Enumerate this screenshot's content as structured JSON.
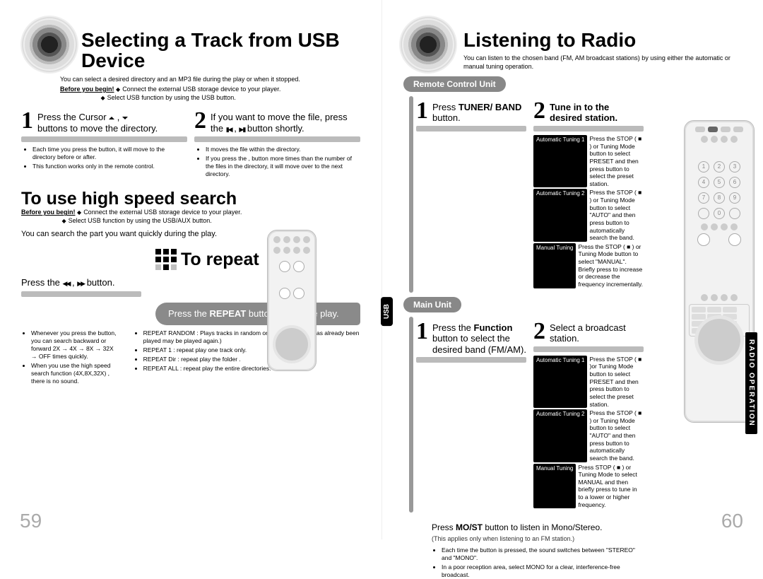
{
  "left": {
    "title": "Selecting a Track from USB Device",
    "intro": "You can select a desired directory and an MP3 file during the play or when it stopped.",
    "before_label": "Before you begin!",
    "before1": "Connect the external USB storage device to your player.",
    "before2": "Select USB function by using the USB button.",
    "step1": {
      "text_a": "Press the Cursor ",
      "text_b": " , ",
      "text_c": " buttons to move the directory.",
      "n1": "Each time you press the button, it will move to the directory before or after.",
      "n2": "This function works only in the remote control."
    },
    "step2": {
      "text_a": "If you want to move the file, press the ",
      "text_b": " , ",
      "text_c": "button shortly.",
      "n1": "It moves the file within the directory.",
      "n2": "If you press the     ,     button more times than the number of the files in the directory, it will move over to the next directory."
    },
    "h2a": "To use high speed search",
    "hs_before_label": "Before you begin!",
    "hs_b1": "Connect the external USB storage device to your player.",
    "hs_b2": "Select USB function by using the USB/AUX button.",
    "hs_intro": "You can search the part you want quickly during the play.",
    "hs_press_a": "Press the ",
    "hs_press_b": " , ",
    "hs_press_c": " button.",
    "hs_n1": "Whenever you press the button, you can search backward or forward 2X → 4X → 8X → 32X → OFF times quickly.",
    "hs_n2": "When you use the high speed search function (4X,8X,32X) , there is no sound.",
    "repeat_title": "To repeat",
    "repeat_pill_a": "Press the ",
    "repeat_pill_b": "REPEAT",
    "repeat_pill_c": " button during the play.",
    "rp_n1": "REPEAT RANDOM : Plays tracks in random order. (A track that has already been played may be played again.)",
    "rp_n2": "REPEAT 1 : repeat play one track only.",
    "rp_n3": "REPEAT Dir : repeat play the folder .",
    "rp_n4": "REPEAT ALL : repeat play the entire directories.",
    "page": "59"
  },
  "right": {
    "title": "Listening to Radio",
    "intro": "You can listen to the chosen band (FM, AM broadcast stations) by using either the automatic or manual tuning operation.",
    "remote_header": "Remote Control Unit",
    "r1_a": "Press ",
    "r1_b": "TUNER/ BAND",
    "r1_c": " button.",
    "r2_a": "Tune in to the desired station.",
    "at1": "Automatic Tuning 1",
    "at2": "Automatic Tuning 2",
    "mt": "Manual Tuning",
    "r_at1": "Press the STOP ( ■ ) or Tuning Mode button to select PRESET and then press      button to select the preset station.",
    "r_at2": "Press the STOP ( ■ ) or Tuning Mode button to select \"AUTO\" and then press      button to automatically search the band.",
    "r_mt": "Press the STOP ( ■ ) or Tuning Mode button to select \"MANUAL\". Briefly press      to increase or decrease the frequency incrementally.",
    "main_header": "Main Unit",
    "m1_a": "Press the ",
    "m1_b": "Function",
    "m1_c": " button to select the desired band (FM/AM).",
    "m2": "Select a broadcast station.",
    "m_at1": "Press the STOP ( ■ )or Tuning Mode button to select PRESET and then press      button to select the preset station.",
    "m_at2": "Press the STOP ( ■ ) or Tuning Mode button to select \"AUTO\" and then press      button to automatically search the band.",
    "m_mt": "Press STOP ( ■ ) or Tuning Mode to select MANUAL and then briefly press      to tune in to a lower or higher frequency.",
    "most_a": "Press ",
    "most_b": "MO/ST",
    "most_c": " button to listen in Mono/Stereo.",
    "most_sub": "(This applies only when listening to an FM station.)",
    "most_n1": "Each time the button is pressed, the sound switches between \"STEREO\" and \"MONO\".",
    "most_n2": "In a poor reception area, select MONO for a clear, interference-free broadcast.",
    "usb_tab": "USB",
    "side_tab": "RADIO OPERATION",
    "page": "60"
  }
}
